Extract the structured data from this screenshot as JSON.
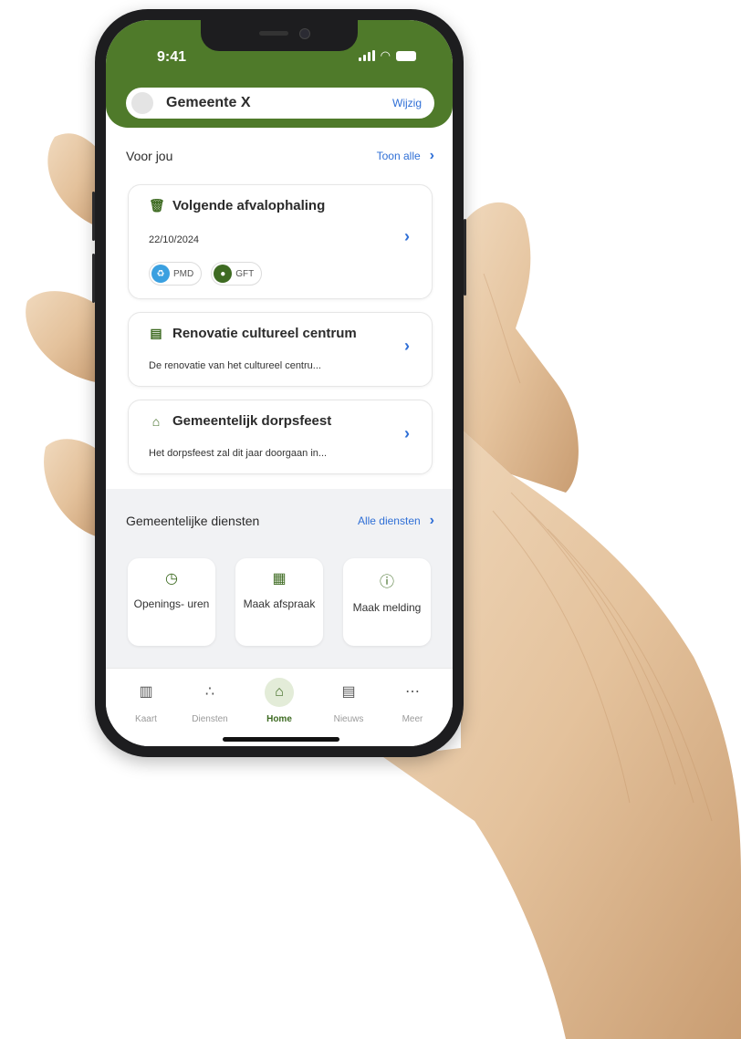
{
  "status_bar": {
    "time": "9:41"
  },
  "header": {
    "municipality": "Gemeente X",
    "change_label": "Wijzig"
  },
  "for_you": {
    "title": "Voor jou",
    "link": "Toon alle",
    "cards": [
      {
        "title": "Volgende afvalophaling",
        "date": "22/10/2024",
        "chips": [
          {
            "label": "PMD",
            "color": "#3aa0e0"
          },
          {
            "label": "GFT",
            "color": "#3e6b22"
          }
        ]
      },
      {
        "title": "Renovatie cultureel centrum",
        "subtitle": "De renovatie van het cultureel centru..."
      },
      {
        "title": "Gemeentelijk dorpsfeest",
        "subtitle": "Het dorpsfeest zal dit jaar doorgaan in..."
      }
    ]
  },
  "services": {
    "title": "Gemeentelijke diensten",
    "link": "Alle diensten",
    "items": [
      {
        "label": "Openings- uren",
        "icon": "clock-icon"
      },
      {
        "label": "Maak afspraak",
        "icon": "calendar-icon"
      },
      {
        "label": "Maak melding",
        "icon": "alert-icon"
      }
    ]
  },
  "tabs": [
    {
      "label": "Kaart",
      "icon": "map-icon",
      "active": false
    },
    {
      "label": "Diensten",
      "icon": "services-icon",
      "active": false
    },
    {
      "label": "Home",
      "icon": "home-icon",
      "active": true
    },
    {
      "label": "Nieuws",
      "icon": "news-icon",
      "active": false
    },
    {
      "label": "Meer",
      "icon": "more-icon",
      "active": false
    }
  ],
  "colors": {
    "brand_green": "#4f7a2a",
    "link_blue": "#2f6fd6",
    "active_tab_bg": "#e3ecd8"
  }
}
